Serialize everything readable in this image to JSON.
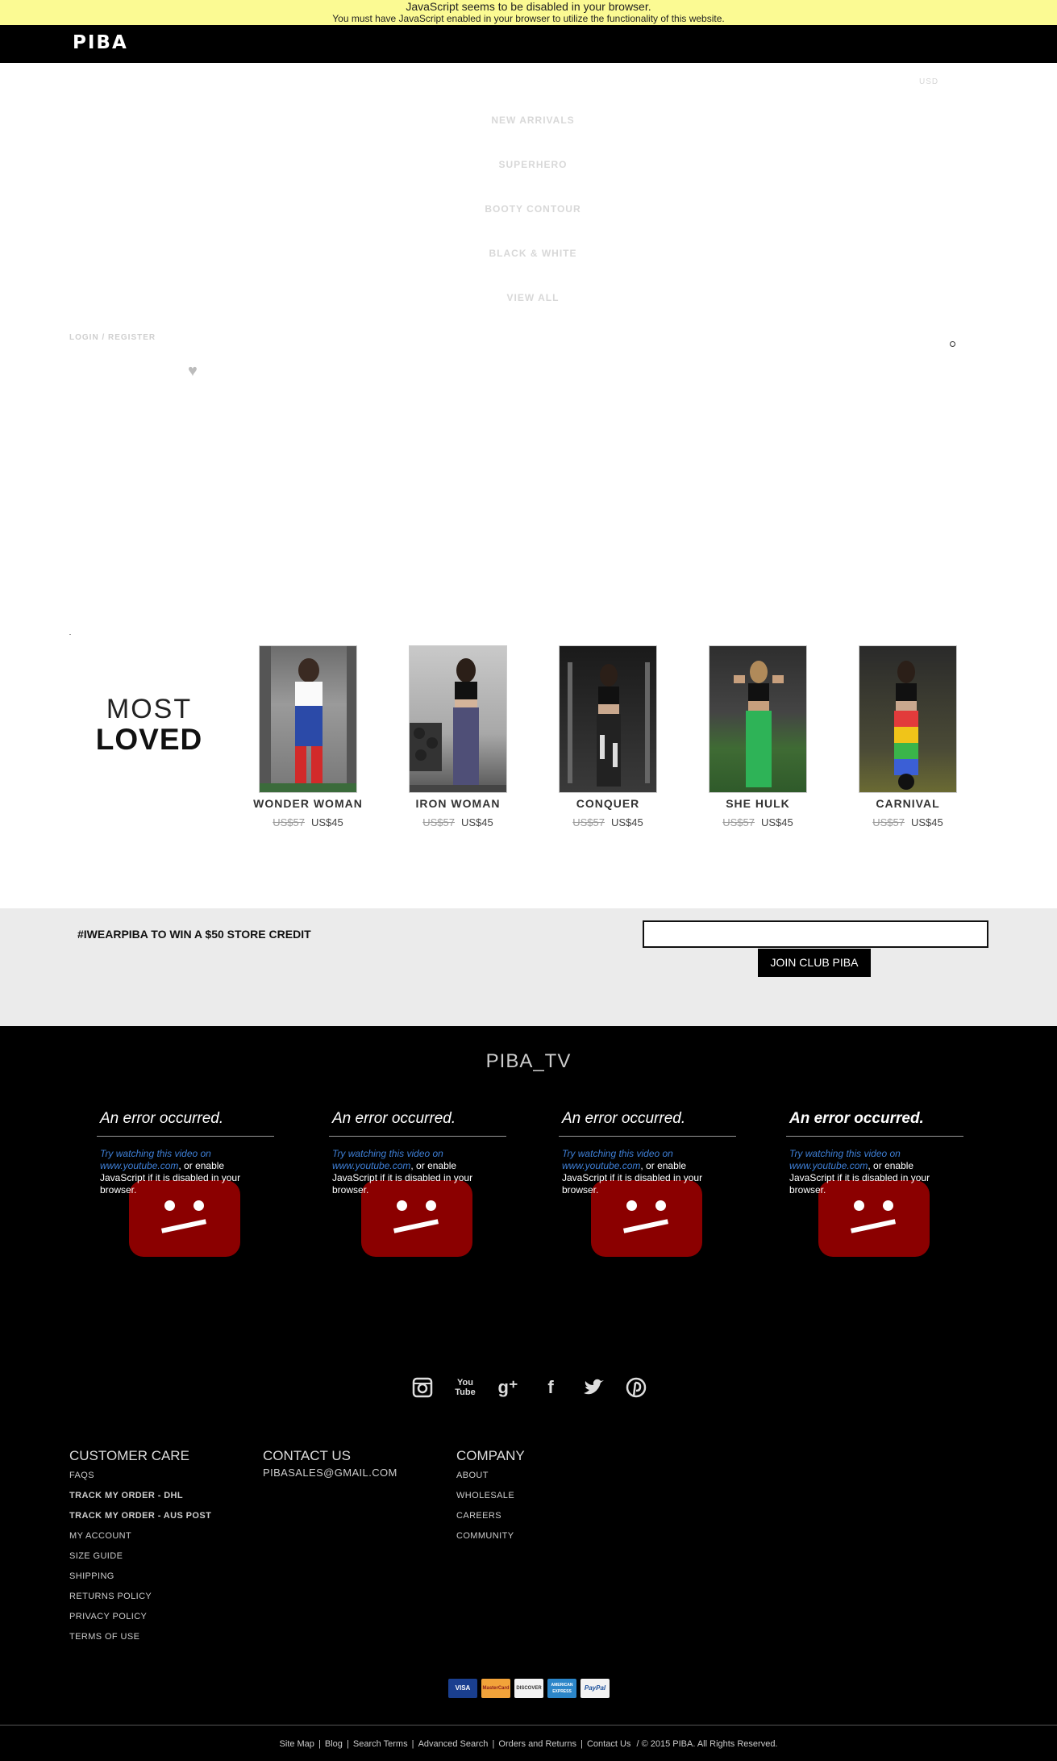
{
  "notice": {
    "title": "JavaScript seems to be disabled in your browser.",
    "message": "You must have JavaScript enabled in your browser to utilize the functionality of this website."
  },
  "header": {
    "logo": "PIBA",
    "currency": "USD",
    "login": "LOGIN / REGISTER"
  },
  "nav": [
    {
      "label": "NEW ARRIVALS"
    },
    {
      "label": "SUPERHERO"
    },
    {
      "label": "BOOTY CONTOUR"
    },
    {
      "label": "BLACK & WHITE"
    },
    {
      "label": "VIEW ALL"
    }
  ],
  "most_loved": {
    "line1": "MOST",
    "line2": "LOVED",
    "products": [
      {
        "name": "WONDER WOMAN",
        "old_price": "US$57",
        "price": "US$45"
      },
      {
        "name": "IRON WOMAN",
        "old_price": "US$57",
        "price": "US$45"
      },
      {
        "name": "CONQUER",
        "old_price": "US$57",
        "price": "US$45"
      },
      {
        "name": "SHE HULK",
        "old_price": "US$57",
        "price": "US$45"
      },
      {
        "name": "CARNIVAL",
        "old_price": "US$57",
        "price": "US$45"
      }
    ]
  },
  "promo": {
    "text": "#IWEARPIBA TO WIN A $50 STORE CREDIT",
    "button": "JOIN CLUB PIBA"
  },
  "tv": {
    "title": "PIBA_TV",
    "videos": [
      {
        "error": "An error occurred.",
        "link": "Try watching this video on www.youtube.com",
        "rest": ", or enable JavaScript if it is disabled in your browser."
      },
      {
        "error": "An error occurred.",
        "link": "Try watching this video on www.youtube.com",
        "rest": ", or enable JavaScript if it is disabled in your browser."
      },
      {
        "error": "An error occurred.",
        "link": "Try watching this video on www.youtube.com",
        "rest": ", or enable JavaScript if it is disabled in your browser."
      },
      {
        "error": "An error occurred.",
        "link": "Try watching this video on www.youtube.com",
        "rest": ", or enable JavaScript if it is disabled in your browser."
      }
    ]
  },
  "social": [
    "instagram-icon",
    "youtube-icon",
    "google-plus-icon",
    "facebook-icon",
    "twitter-icon",
    "pinterest-icon"
  ],
  "footer": {
    "customer_care": {
      "heading": "CUSTOMER CARE",
      "links": [
        "FAQS",
        "TRACK MY ORDER - DHL",
        "TRACK MY ORDER - AUS POST",
        "MY ACCOUNT",
        "SIZE GUIDE",
        "SHIPPING",
        "RETURNS POLICY",
        "PRIVACY POLICY",
        "TERMS OF USE"
      ]
    },
    "contact": {
      "heading": "CONTACT US",
      "email": "PIBASALES@GMAIL.COM"
    },
    "company": {
      "heading": "COMPANY",
      "links": [
        "ABOUT",
        "WHOLESALE",
        "CAREERS",
        "COMMUNITY"
      ]
    },
    "payments": [
      "VISA",
      "MasterCard",
      "DISCOVER",
      "AMERICAN EXPRESS",
      "PayPal"
    ],
    "bottom_links": [
      "Site Map",
      "Blog",
      "Search Terms",
      "Advanced Search",
      "Orders and Returns",
      "Contact Us"
    ],
    "copyright": "/ © 2015 PIBA. All Rights Reserved."
  }
}
